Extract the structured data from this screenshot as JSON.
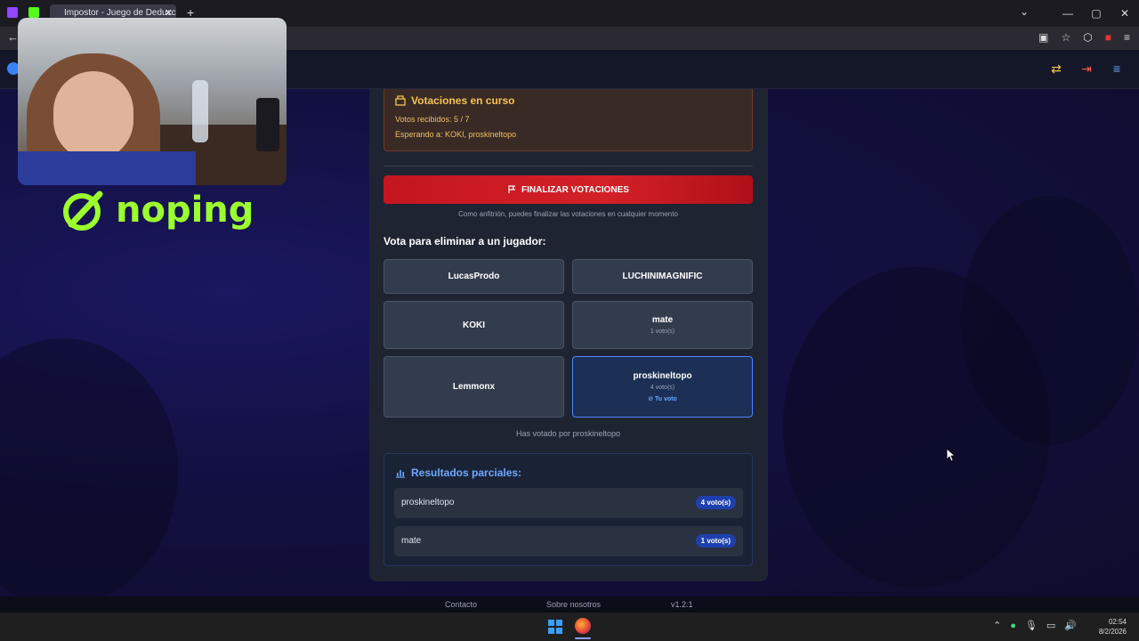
{
  "browser": {
    "tab_title": "Impostor - Juego de Deducción",
    "tab_close": "✕",
    "new_tab": "+",
    "window_controls": [
      "⌄",
      "—",
      "▢",
      "✕"
    ]
  },
  "overlay": {
    "brand_text": "noping"
  },
  "status_card": {
    "title": "Votaciones en curso",
    "votes_received": "Votos recibidos: 5 / 7",
    "waiting_for": "Esperando a: KOKI, proskineltopo"
  },
  "finalize": {
    "label": "FINALIZAR VOTACIONES",
    "hint": "Como anfitrión, puedes finalizar las votaciones en cualquier momento"
  },
  "vote": {
    "heading": "Vota para eliminar a un jugador:",
    "players": [
      {
        "name": "LucasProdo"
      },
      {
        "name": "LUCHINIMAGNIFIC"
      },
      {
        "name": "KOKI"
      },
      {
        "name": "mate",
        "count": "1 voto(s)"
      },
      {
        "name": "Lemmonx"
      },
      {
        "name": "proskineltopo",
        "count": "4 voto(s)",
        "you": "Tu voto"
      }
    ],
    "voted_note": "Has votado por proskineltopo"
  },
  "results": {
    "title": "Resultados parciales:",
    "rows": [
      {
        "name": "proskineltopo",
        "badge": "4 voto(s)"
      },
      {
        "name": "mate",
        "badge": "1 voto(s)"
      }
    ]
  },
  "footer": {
    "contact": "Contacto",
    "about": "Sobre nosotros",
    "version": "v1.2.1"
  },
  "taskbar": {
    "time": "02:54",
    "date": "8/2/2026"
  },
  "colors": {
    "accent_red": "#d42027",
    "accent_blue": "#4d86ff",
    "brand_green": "#9cff2e",
    "warning_text": "#f5c453"
  }
}
